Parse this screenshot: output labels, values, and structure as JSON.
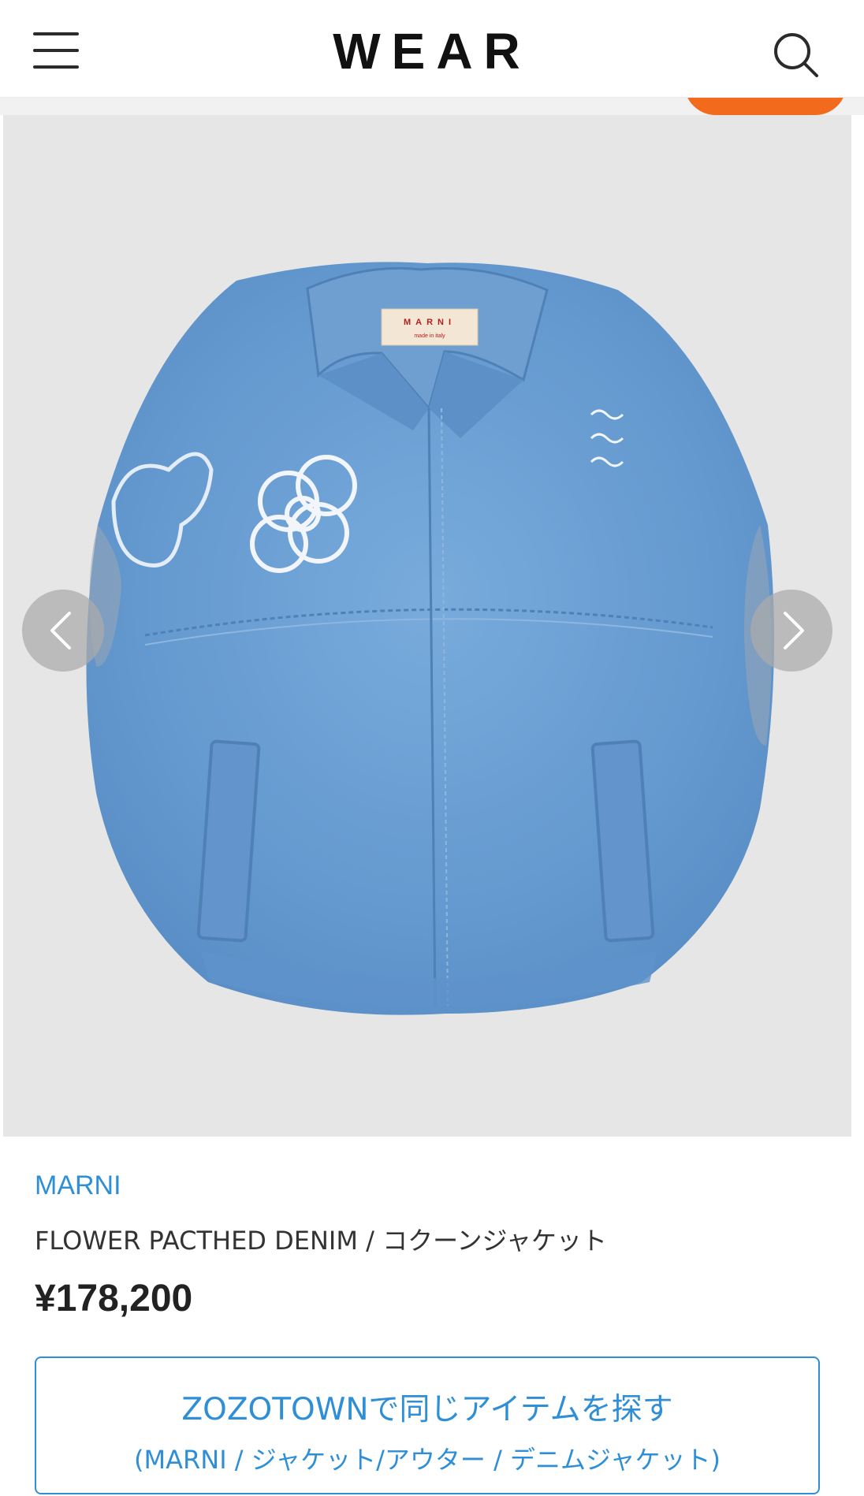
{
  "header": {
    "logo": "WEAR",
    "menu_icon": "hamburger-menu-icon",
    "search_icon": "search-icon"
  },
  "colors": {
    "accent": "#2f8fd6",
    "orange": "#f26b1d",
    "image_bg": "#e6e6e6",
    "denim": "#6a9fd3"
  },
  "gallery": {
    "image": "denim-cocoon-vest-photo",
    "prev_icon": "chevron-left-icon",
    "next_icon": "chevron-right-icon"
  },
  "product": {
    "brand": "MARNI",
    "name": "FLOWER PACTHED DENIM / コクーンジャケット",
    "price": "¥178,200"
  },
  "zozo_button": {
    "label": "ZOZOTOWNで同じアイテムを探す",
    "category": "(MARNI / ジャケット/アウター / デニムジャケット)"
  }
}
